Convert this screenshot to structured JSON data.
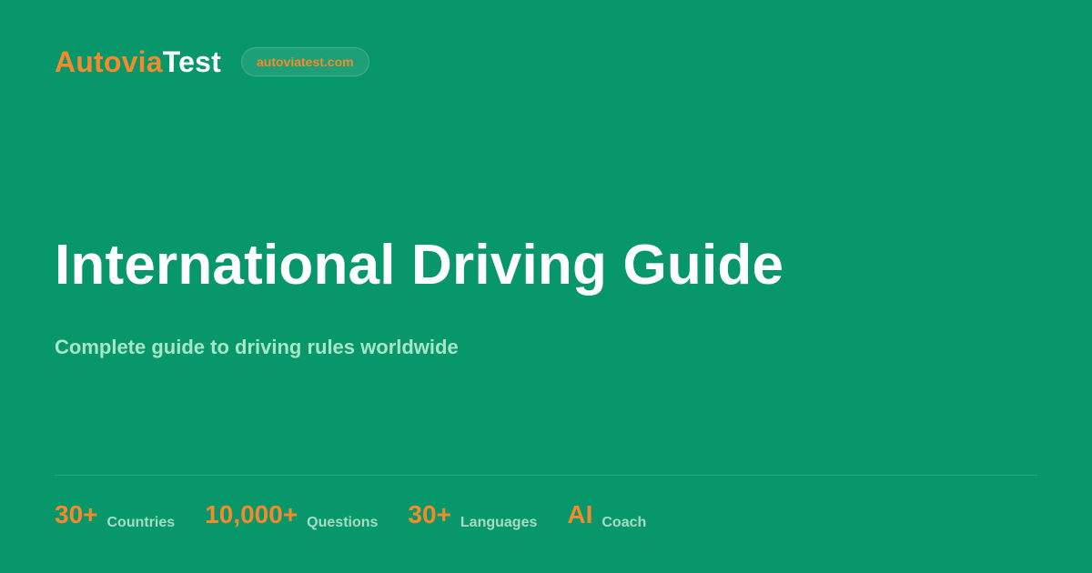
{
  "brand": {
    "name_part1": "Autovia",
    "name_part2": "Test",
    "url": "autoviatest.com"
  },
  "hero": {
    "title": "International Driving Guide",
    "subtitle": "Complete guide to driving rules worldwide"
  },
  "stats": [
    {
      "value": "30+",
      "label": "Countries"
    },
    {
      "value": "10,000+",
      "label": "Questions"
    },
    {
      "value": "30+",
      "label": "Languages"
    },
    {
      "value": "AI",
      "label": "Coach"
    }
  ],
  "colors": {
    "background": "#07976a",
    "accent": "#f38a2b",
    "title": "#ffffff",
    "subtitle": "#a7e6c7",
    "stat_label": "#a7dcc3"
  }
}
